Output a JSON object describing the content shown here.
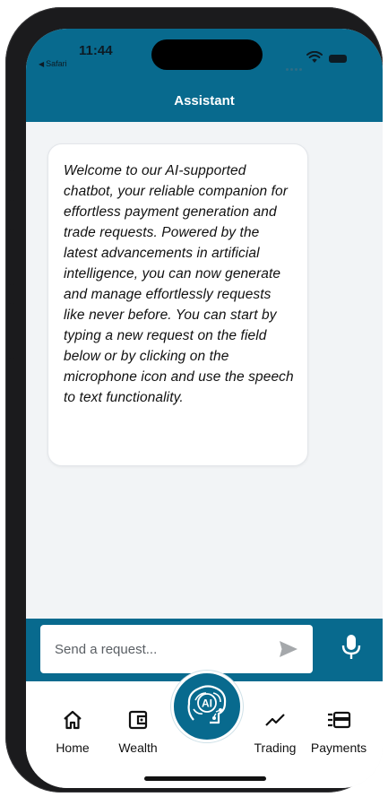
{
  "status_bar": {
    "time": "11:44",
    "back_label": "Safari",
    "icons": [
      "wifi-icon",
      "battery-icon"
    ]
  },
  "header": {
    "title": "Assistant"
  },
  "chat": {
    "messages": [
      {
        "sender": "assistant",
        "text": "Welcome to our AI-supported chatbot, your reliable companion for effortless payment generation and trade requests. Powered by the latest advancements in artificial intelligence, you can now generate and manage effortlessly requests like never before. You can start by typing a new request on the field below or by clicking on the microphone icon and use the speech to text functionality."
      }
    ]
  },
  "composer": {
    "placeholder": "Send a request...",
    "value": "",
    "icons": [
      "send-icon",
      "microphone-icon"
    ]
  },
  "nav": {
    "items": [
      {
        "label": "Home",
        "icon": "home-icon"
      },
      {
        "label": "Wealth",
        "icon": "wallet-icon"
      },
      {
        "label": "AI",
        "icon": "ai-brain-icon"
      },
      {
        "label": "Trading",
        "icon": "trend-icon"
      },
      {
        "label": "Payments",
        "icon": "payment-card-icon"
      }
    ]
  },
  "colors": {
    "brand": "#086a8e",
    "background": "#f2f4f6",
    "bubble": "#ffffff",
    "text": "#111111"
  }
}
